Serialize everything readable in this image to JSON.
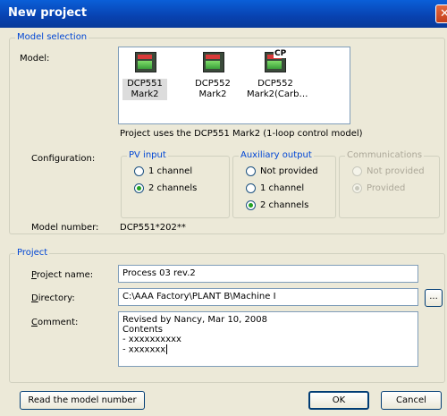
{
  "window": {
    "title": "New project",
    "close_glyph": "✕"
  },
  "model_selection": {
    "legend": "Model selection",
    "model_label": "Model:",
    "models": [
      {
        "name_line1": "DCP551",
        "name_line2": "Mark2",
        "selected": true
      },
      {
        "name_line1": "DCP552",
        "name_line2": "Mark2",
        "selected": false
      },
      {
        "name_line1": "DCP552",
        "name_line2": "Mark2(Carb…",
        "badge": "CP",
        "selected": false
      }
    ],
    "description": "Project uses the DCP551 Mark2 (1-loop control model)",
    "configuration_label": "Configuration:",
    "pv_input": {
      "legend": "PV input",
      "options": [
        "1 channel",
        "2 channels"
      ],
      "selected": "2 channels"
    },
    "auxiliary_output": {
      "legend": "Auxiliary output",
      "options": [
        "Not provided",
        "1 channel",
        "2 channels"
      ],
      "selected": "2 channels"
    },
    "communications": {
      "legend": "Communications",
      "options": [
        "Not provided",
        "Provided"
      ],
      "selected": "Provided",
      "disabled": true
    },
    "model_number_label": "Model number:",
    "model_number_value": "DCP551*202**"
  },
  "project": {
    "legend": "Project",
    "name_label_prefix": "P",
    "name_label_rest": "roject name:",
    "name_value": "Process 03 rev.2",
    "directory_label_prefix": "D",
    "directory_label_rest": "irectory:",
    "directory_value": "C:\\AAA Factory\\PLANT B\\Machine I",
    "browse_label": "...",
    "comment_label_prefix": "C",
    "comment_label_rest": "omment:",
    "comment_lines": [
      "Revised by Nancy, Mar 10, 2008",
      "Contents",
      "- xxxxxxxxxx",
      "- xxxxxxx"
    ]
  },
  "footer": {
    "read_model_label": "Read the model number",
    "ok_label": "OK",
    "cancel_label": "Cancel"
  },
  "colors": {
    "title_bar": "#0a5fd8",
    "group_legend": "#0046d5",
    "dialog_bg": "#ece9d8",
    "radio_dot": "#21a121"
  }
}
